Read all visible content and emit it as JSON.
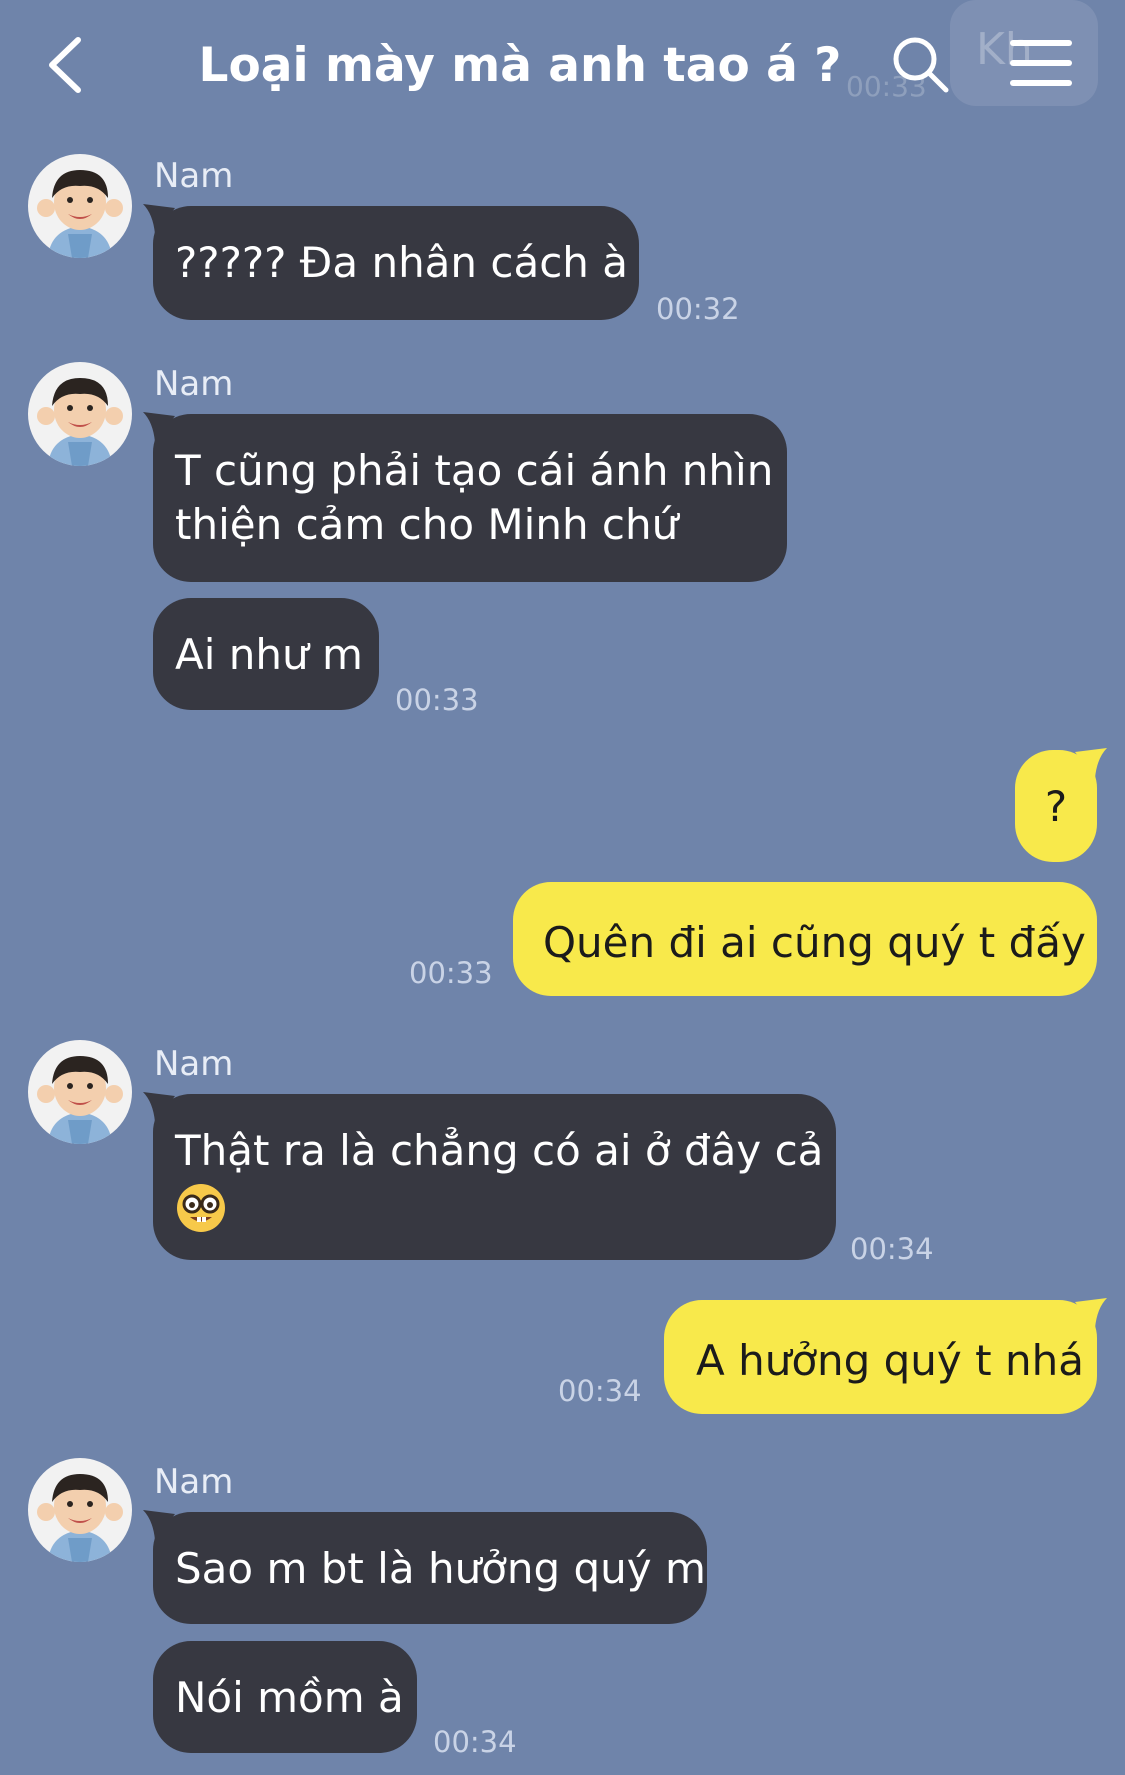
{
  "header": {
    "title": "Loại mày mà anh tao á ?",
    "ghost_time": "00:33",
    "ghost_label": "Kh"
  },
  "messages": [
    {
      "sender": "Nam",
      "text": "????? Đa nhân cách à",
      "time": "00:32"
    },
    {
      "sender": "Nam",
      "text_line1": "T cũng phải tạo cái ánh nhìn",
      "text_line2": "thiện cảm cho Minh chứ"
    },
    {
      "text": "Ai như m",
      "time": "00:33"
    },
    {
      "text": "?"
    },
    {
      "text": "Quên đi ai cũng quý t đấy",
      "time": "00:33"
    },
    {
      "sender": "Nam",
      "text_line1": "Thật ra là chẳng có ai ở đây cả",
      "emoji": "nerd-face",
      "time": "00:34"
    },
    {
      "text": "A hưởng quý t nhá",
      "time": "00:34"
    },
    {
      "sender": "Nam",
      "text": "Sao m bt là hưởng quý m"
    },
    {
      "text": "Nói mồm à",
      "time": "00:34"
    }
  ],
  "colors": {
    "background": "#6f84aa",
    "incoming_bubble": "#373841",
    "outgoing_bubble": "#f8e94b"
  }
}
